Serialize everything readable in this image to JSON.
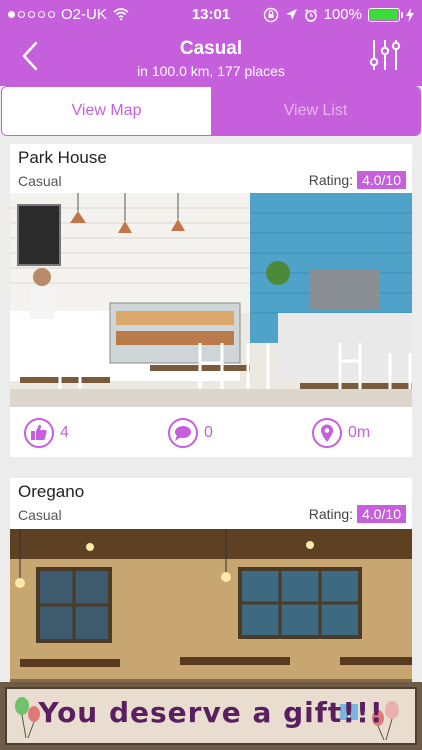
{
  "statusbar": {
    "carrier": "O2-UK",
    "time": "13:01",
    "battery": "100%"
  },
  "header": {
    "title": "Casual",
    "subtitle": "in 100.0 km, 177 places"
  },
  "segment": {
    "map_label": "View Map",
    "list_label": "View List"
  },
  "places": [
    {
      "name": "Park House",
      "category": "Casual",
      "rating_label": "Rating:",
      "rating": "4.0/10",
      "likes": "4",
      "comments": "0",
      "distance": "0m"
    },
    {
      "name": "Oregano",
      "category": "Casual",
      "rating_label": "Rating:",
      "rating": "4.0/10"
    }
  ],
  "banner": {
    "text": "You deserve a gift!!!"
  },
  "colors": {
    "accent": "#c65fdc",
    "battery": "#3cdc3c"
  },
  "icons": [
    "back-icon",
    "filter-sliders-icon",
    "thumbs-up-icon",
    "comment-icon",
    "location-pin-icon",
    "wifi-icon",
    "lock-rotation-icon",
    "location-arrow-icon",
    "alarm-icon",
    "charging-icon",
    "gift-icon",
    "balloon-icon"
  ]
}
